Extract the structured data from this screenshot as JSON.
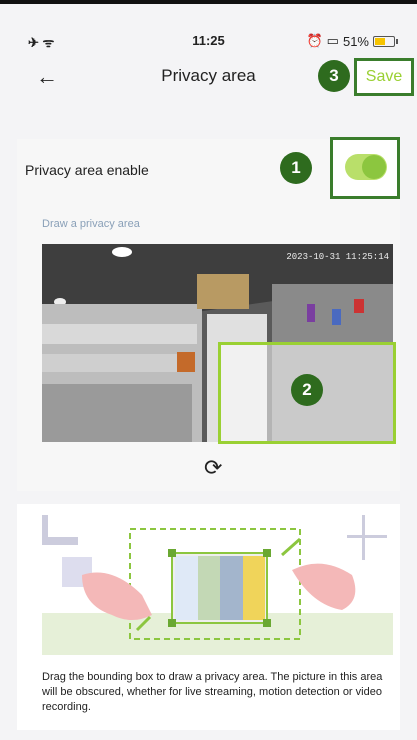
{
  "status_bar": {
    "time": "11:25",
    "battery": "51%",
    "battery_level": 0.51
  },
  "nav": {
    "title": "Privacy area",
    "save_label": "Save"
  },
  "badges": [
    "1",
    "2",
    "3"
  ],
  "privacy": {
    "enable_label": "Privacy area enable",
    "enabled": true,
    "draw_label": "Draw a privacy area",
    "camera_timestamp": "2023-10-31 11:25:14"
  },
  "help": {
    "description": "Drag the bounding box to draw a privacy area. The picture in this area will be obscured, whether for live streaming, motion detection or video recording."
  },
  "colors": {
    "accent": "#9ad033",
    "badge": "#2e6b1e",
    "frame": "#3a7d2c"
  }
}
